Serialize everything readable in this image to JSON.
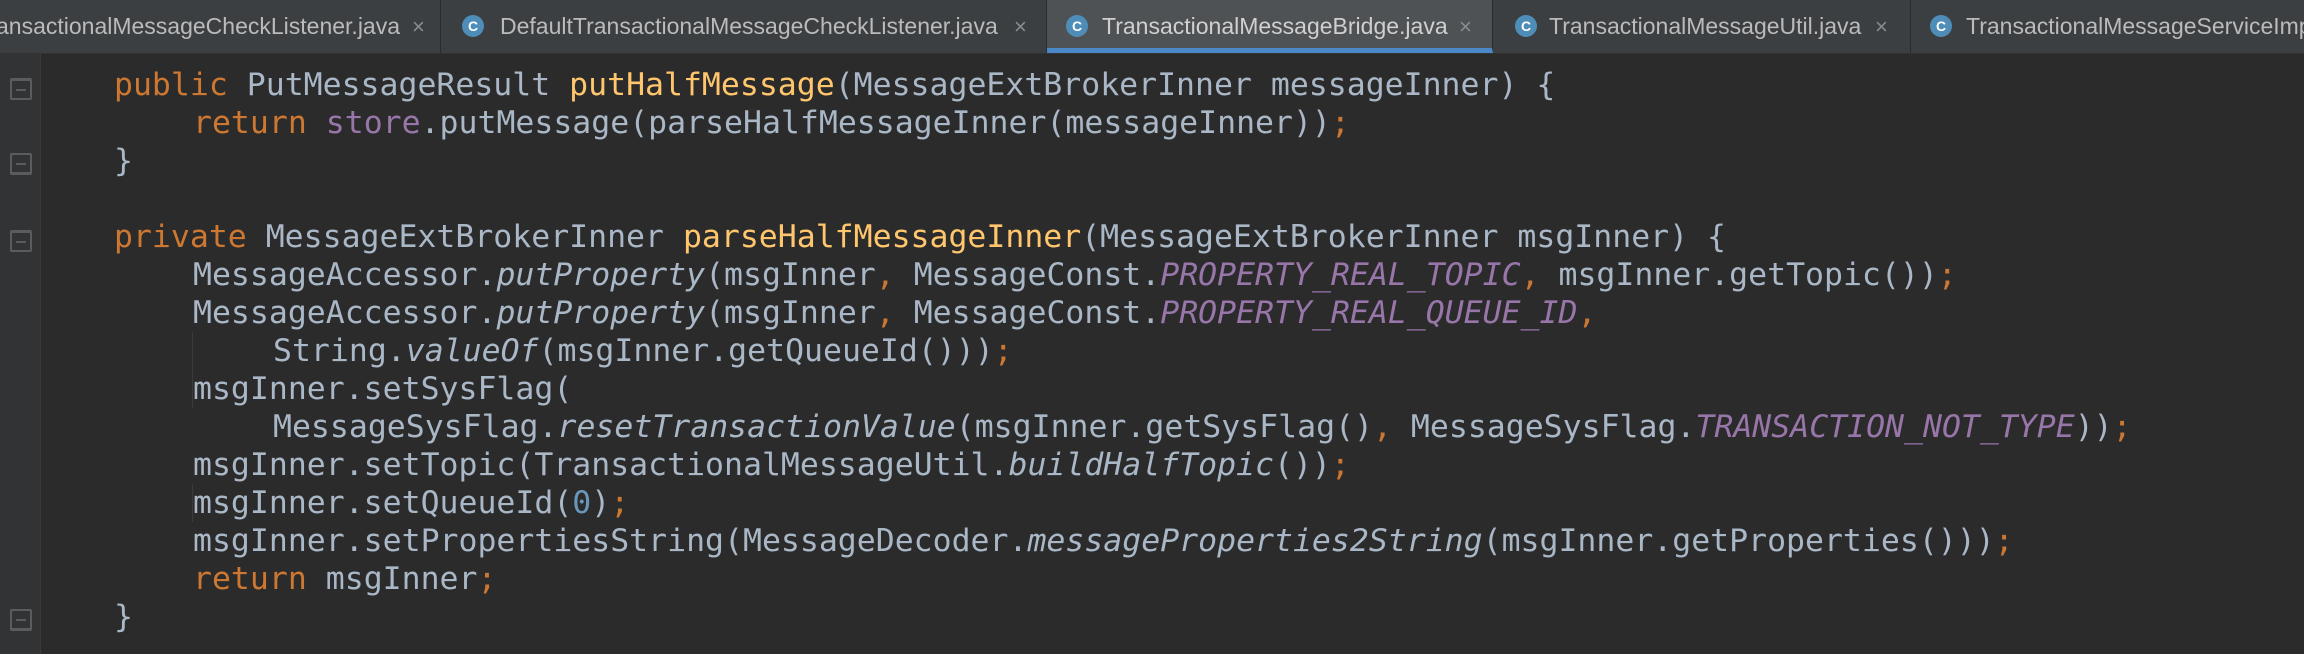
{
  "tabs": [
    {
      "label": "ansactionalMessageCheckListener.java",
      "has_close": true,
      "active": false,
      "icon": "class-icon"
    },
    {
      "label": "DefaultTransactionalMessageCheckListener.java",
      "has_close": true,
      "active": false,
      "icon": "class-icon"
    },
    {
      "label": "TransactionalMessageBridge.java",
      "has_close": true,
      "active": true,
      "icon": "class-icon"
    },
    {
      "label": "TransactionalMessageUtil.java",
      "has_close": true,
      "active": false,
      "icon": "class-icon"
    },
    {
      "label": "TransactionalMessageServiceImp",
      "has_close": false,
      "active": false,
      "icon": "class-icon"
    }
  ],
  "tab_close_glyph": "×",
  "tab_icon_letter": "C",
  "code_lines": [
    [
      [
        "kw",
        "public "
      ],
      [
        "",
        "PutMessageResult "
      ],
      [
        "fn",
        "putHalfMessage"
      ],
      [
        "",
        "(MessageExtBrokerInner messageInner) {"
      ]
    ],
    [
      [
        "kw",
        "return "
      ],
      [
        "fld",
        "store"
      ],
      [
        "",
        ".putMessage(parseHalfMessageInner(messageInner))"
      ],
      [
        "pun",
        ";"
      ]
    ],
    [
      [
        "",
        "}"
      ]
    ],
    [],
    [
      [
        "kw",
        "private "
      ],
      [
        "",
        "MessageExtBrokerInner "
      ],
      [
        "fn",
        "parseHalfMessageInner"
      ],
      [
        "",
        "(MessageExtBrokerInner msgInner) {"
      ]
    ],
    [
      [
        "",
        "MessageAccessor."
      ],
      [
        "st",
        "putProperty"
      ],
      [
        "",
        "(msgInner"
      ],
      [
        "pun",
        ", "
      ],
      [
        "",
        "MessageConst."
      ],
      [
        "cst",
        "PROPERTY_REAL_TOPIC"
      ],
      [
        "pun",
        ", "
      ],
      [
        "",
        "msgInner.getTopic())"
      ],
      [
        "pun",
        ";"
      ]
    ],
    [
      [
        "",
        "MessageAccessor."
      ],
      [
        "st",
        "putProperty"
      ],
      [
        "",
        "(msgInner"
      ],
      [
        "pun",
        ", "
      ],
      [
        "",
        "MessageConst."
      ],
      [
        "cst",
        "PROPERTY_REAL_QUEUE_ID"
      ],
      [
        "pun",
        ","
      ]
    ],
    [
      [
        "",
        "String."
      ],
      [
        "st",
        "valueOf"
      ],
      [
        "",
        "(msgInner.getQueueId()))"
      ],
      [
        "pun",
        ";"
      ]
    ],
    [
      [
        "",
        "msgInner.setSysFlag("
      ]
    ],
    [
      [
        "",
        "MessageSysFlag."
      ],
      [
        "st",
        "resetTransactionValue"
      ],
      [
        "",
        "(msgInner.getSysFlag()"
      ],
      [
        "pun",
        ", "
      ],
      [
        "",
        "MessageSysFlag."
      ],
      [
        "cst",
        "TRANSACTION_NOT_TYPE"
      ],
      [
        "",
        "))"
      ],
      [
        "pun",
        ";"
      ]
    ],
    [
      [
        "",
        "msgInner.setTopic(TransactionalMessageUtil."
      ],
      [
        "st",
        "buildHalfTopic"
      ],
      [
        "",
        "())"
      ],
      [
        "pun",
        ";"
      ]
    ],
    [
      [
        "",
        "msgInner.setQueueId("
      ],
      [
        "num",
        "0"
      ],
      [
        "",
        ")"
      ],
      [
        "pun",
        ";"
      ]
    ],
    [
      [
        "",
        "msgInner.setPropertiesString(MessageDecoder."
      ],
      [
        "st",
        "messageProperties2String"
      ],
      [
        "",
        "(msgInner.getProperties()))"
      ],
      [
        "pun",
        ";"
      ]
    ],
    [
      [
        "kw",
        "return "
      ],
      [
        "",
        "msgInner"
      ],
      [
        "pun",
        ";"
      ]
    ],
    [
      [
        "",
        "}"
      ]
    ]
  ]
}
